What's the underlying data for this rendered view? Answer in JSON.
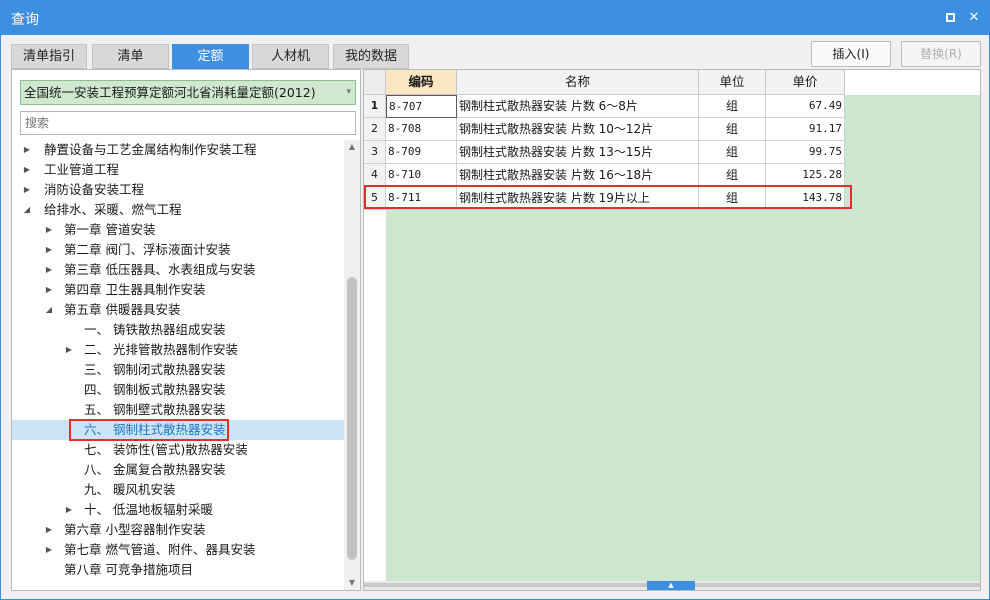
{
  "window": {
    "title": "查询",
    "maximize_label": "",
    "close_label": "✕"
  },
  "tabs": [
    {
      "label": "清单指引",
      "active": false
    },
    {
      "label": "清单",
      "active": false
    },
    {
      "label": "定额",
      "active": true
    },
    {
      "label": "人材机",
      "active": false
    },
    {
      "label": "我的数据",
      "active": false
    }
  ],
  "actions": {
    "insert_label": "插入(I)",
    "replace_label": "替换(R)"
  },
  "left_panel": {
    "quota_book": "全国统一安装工程预算定额河北省消耗量定额(2012)",
    "search_placeholder": "搜索",
    "tree": [
      {
        "label": "静置设备与工艺金属结构制作安装工程",
        "expander": "collapsed"
      },
      {
        "label": "工业管道工程",
        "expander": "collapsed"
      },
      {
        "label": "消防设备安装工程",
        "expander": "collapsed"
      },
      {
        "label": "给排水、采暖、燃气工程",
        "expander": "expanded"
      },
      {
        "label": "第一章 管道安装",
        "expander": "collapsed"
      },
      {
        "label": "第二章 阀门、浮标液面计安装",
        "expander": "collapsed"
      },
      {
        "label": "第三章 低压器具、水表组成与安装",
        "expander": "collapsed"
      },
      {
        "label": "第四章 卫生器具制作安装",
        "expander": "collapsed"
      },
      {
        "label": "第五章 供暖器具安装",
        "expander": "expanded"
      },
      {
        "label": "一、 铸铁散热器组成安装",
        "expander": "none"
      },
      {
        "label": "二、 光排管散热器制作安装",
        "expander": "collapsed"
      },
      {
        "label": "三、 钢制闭式散热器安装",
        "expander": "none"
      },
      {
        "label": "四、 钢制板式散热器安装",
        "expander": "none"
      },
      {
        "label": "五、 钢制壁式散热器安装",
        "expander": "none"
      },
      {
        "label": "六、 钢制柱式散热器安装",
        "expander": "none",
        "selected": true
      },
      {
        "label": "七、 装饰性(管式)散热器安装",
        "expander": "none"
      },
      {
        "label": "八、 金属复合散热器安装",
        "expander": "none"
      },
      {
        "label": "九、 暖风机安装",
        "expander": "none"
      },
      {
        "label": "十、 低温地板辐射采暖",
        "expander": "collapsed"
      },
      {
        "label": "第六章 小型容器制作安装",
        "expander": "collapsed"
      },
      {
        "label": "第七章 燃气管道、附件、器具安装",
        "expander": "collapsed"
      },
      {
        "label": "第八章 可竞争措施项目",
        "expander": "none"
      }
    ]
  },
  "grid": {
    "columns": [
      "编码",
      "名称",
      "单位",
      "单价"
    ],
    "rows": [
      {
        "num": "1",
        "code": "8-707",
        "name": "钢制柱式散热器安装 片数 6～8片",
        "unit": "组",
        "price": "67.49"
      },
      {
        "num": "2",
        "code": "8-708",
        "name": "钢制柱式散热器安装 片数 10～12片",
        "unit": "组",
        "price": "91.17"
      },
      {
        "num": "3",
        "code": "8-709",
        "name": "钢制柱式散热器安装 片数 13～15片",
        "unit": "组",
        "price": "99.75"
      },
      {
        "num": "4",
        "code": "8-710",
        "name": "钢制柱式散热器安装 片数 16～18片",
        "unit": "组",
        "price": "125.28"
      },
      {
        "num": "5",
        "code": "8-711",
        "name": "钢制柱式散热器安装 片数 19片以上",
        "unit": "组",
        "price": "143.78"
      }
    ]
  },
  "colors": {
    "accent": "#3d8fe0",
    "highlight": "#e0302c",
    "grid_fill": "#cde6cf",
    "select_fill": "#cfe8cf"
  }
}
